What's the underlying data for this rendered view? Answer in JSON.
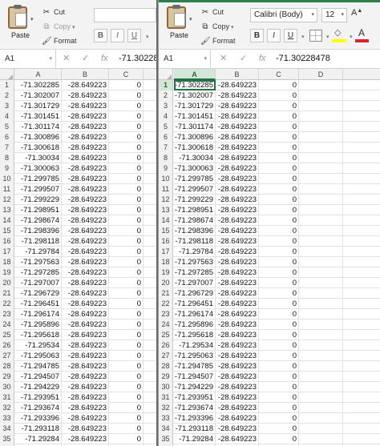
{
  "colors": {
    "accent": "#217346",
    "ribbon": "#f3f3f3",
    "selected_header": "#d4e6d8"
  },
  "clipboard": {
    "paste_label": "Paste",
    "cut_label": "Cut",
    "copy_label": "Copy",
    "format_label": "Format",
    "cut_icon": "scissors-icon",
    "copy_icon": "copy-icon",
    "format_icon": "format-painter-icon",
    "paste_icon": "clipboard-icon"
  },
  "font": {
    "name": "Calibri (Body)",
    "size": "12"
  },
  "format_buttons": {
    "bold": "B",
    "italic": "I",
    "underline": "U"
  },
  "size_buttons": {
    "grow": "A"
  },
  "left": {
    "name_box": "A1",
    "formula_value": "-71.30228",
    "columns": [
      "A",
      "B",
      "C"
    ]
  },
  "right": {
    "name_box": "A1",
    "formula_value": "-71.30228478",
    "columns": [
      "A",
      "B",
      "C",
      "D"
    ]
  },
  "formula_icons": {
    "cancel": "✕",
    "enter": "✓",
    "fx": "fx"
  },
  "rows": [
    {
      "n": "1",
      "a": "-71.302285",
      "b": "-28.649223",
      "c": "0"
    },
    {
      "n": "2",
      "a": "-71.302007",
      "b": "-28.649223",
      "c": "0"
    },
    {
      "n": "3",
      "a": "-71.301729",
      "b": "-28.649223",
      "c": "0"
    },
    {
      "n": "4",
      "a": "-71.301451",
      "b": "-28.649223",
      "c": "0"
    },
    {
      "n": "5",
      "a": "-71.301174",
      "b": "-28.649223",
      "c": "0"
    },
    {
      "n": "6",
      "a": "-71.300896",
      "b": "-28.649223",
      "c": "0"
    },
    {
      "n": "7",
      "a": "-71.300618",
      "b": "-28.649223",
      "c": "0"
    },
    {
      "n": "8",
      "a": "-71.30034",
      "b": "-28.649223",
      "c": "0"
    },
    {
      "n": "9",
      "a": "-71.300063",
      "b": "-28.649223",
      "c": "0"
    },
    {
      "n": "10",
      "a": "-71.299785",
      "b": "-28.649223",
      "c": "0"
    },
    {
      "n": "11",
      "a": "-71.299507",
      "b": "-28.649223",
      "c": "0"
    },
    {
      "n": "12",
      "a": "-71.299229",
      "b": "-28.649223",
      "c": "0"
    },
    {
      "n": "13",
      "a": "-71.298951",
      "b": "-28.649223",
      "c": "0"
    },
    {
      "n": "14",
      "a": "-71.298674",
      "b": "-28.649223",
      "c": "0"
    },
    {
      "n": "15",
      "a": "-71.298396",
      "b": "-28.649223",
      "c": "0"
    },
    {
      "n": "16",
      "a": "-71.298118",
      "b": "-28.649223",
      "c": "0"
    },
    {
      "n": "17",
      "a": "-71.29784",
      "b": "-28.649223",
      "c": "0"
    },
    {
      "n": "18",
      "a": "-71.297563",
      "b": "-28.649223",
      "c": "0"
    },
    {
      "n": "19",
      "a": "-71.297285",
      "b": "-28.649223",
      "c": "0"
    },
    {
      "n": "20",
      "a": "-71.297007",
      "b": "-28.649223",
      "c": "0"
    },
    {
      "n": "21",
      "a": "-71.296729",
      "b": "-28.649223",
      "c": "0"
    },
    {
      "n": "22",
      "a": "-71.296451",
      "b": "-28.649223",
      "c": "0"
    },
    {
      "n": "23",
      "a": "-71.296174",
      "b": "-28.649223",
      "c": "0"
    },
    {
      "n": "24",
      "a": "-71.295896",
      "b": "-28.649223",
      "c": "0"
    },
    {
      "n": "25",
      "a": "-71.295618",
      "b": "-28.649223",
      "c": "0"
    },
    {
      "n": "26",
      "a": "-71.29534",
      "b": "-28.649223",
      "c": "0"
    },
    {
      "n": "27",
      "a": "-71.295063",
      "b": "-28.649223",
      "c": "0"
    },
    {
      "n": "28",
      "a": "-71.294785",
      "b": "-28.649223",
      "c": "0"
    },
    {
      "n": "29",
      "a": "-71.294507",
      "b": "-28.649223",
      "c": "0"
    },
    {
      "n": "30",
      "a": "-71.294229",
      "b": "-28.649223",
      "c": "0"
    },
    {
      "n": "31",
      "a": "-71.293951",
      "b": "-28.649223",
      "c": "0"
    },
    {
      "n": "32",
      "a": "-71.293674",
      "b": "-28.649223",
      "c": "0"
    },
    {
      "n": "33",
      "a": "-71.293396",
      "b": "-28.649223",
      "c": "0"
    },
    {
      "n": "34",
      "a": "-71.293118",
      "b": "-28.649223",
      "c": "0"
    },
    {
      "n": "35",
      "a": "-71.29284",
      "b": "-28.649223",
      "c": "0"
    },
    {
      "n": "36",
      "a": "-71.292563",
      "b": "-28.649223",
      "c": "0"
    }
  ]
}
